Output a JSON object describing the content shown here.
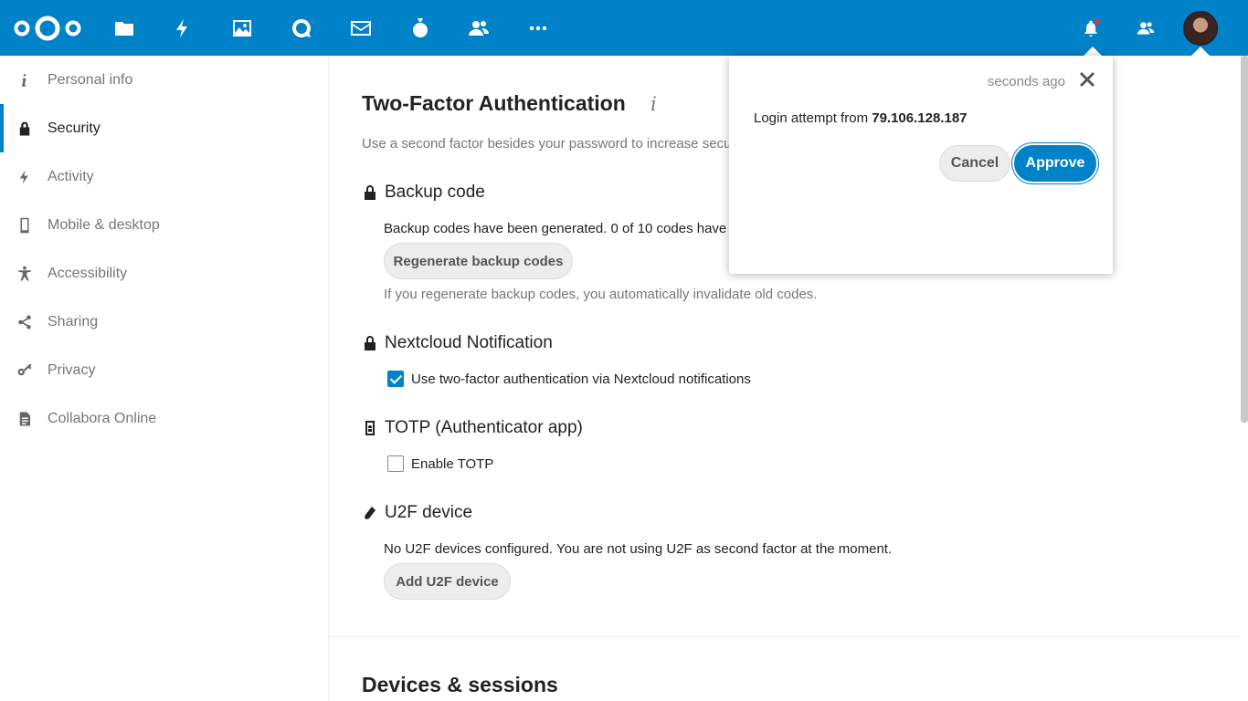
{
  "header": {
    "logo_name": "nextcloud-logo",
    "apps": [
      {
        "name": "files-app-icon"
      },
      {
        "name": "activity-app-icon"
      },
      {
        "name": "photos-app-icon"
      },
      {
        "name": "talk-app-icon"
      },
      {
        "name": "mail-app-icon"
      },
      {
        "name": "deck-app-icon"
      },
      {
        "name": "contacts-app-icon"
      },
      {
        "name": "more-apps-icon"
      }
    ],
    "accent_color": "#0082c9",
    "notification_dot_color": "#e9322d"
  },
  "sidebar": {
    "items": [
      {
        "label": "Personal info",
        "icon": "info-icon"
      },
      {
        "label": "Security",
        "icon": "lock-icon",
        "active": true
      },
      {
        "label": "Activity",
        "icon": "lightning-icon"
      },
      {
        "label": "Mobile & desktop",
        "icon": "phone-icon"
      },
      {
        "label": "Accessibility",
        "icon": "accessibility-icon"
      },
      {
        "label": "Sharing",
        "icon": "share-icon"
      },
      {
        "label": "Privacy",
        "icon": "key-icon"
      },
      {
        "label": "Collabora Online",
        "icon": "document-icon"
      }
    ]
  },
  "main": {
    "title": "Two-Factor Authentication",
    "info_glyph": "i",
    "description": "Use a second factor besides your password to increase secu",
    "backup": {
      "heading": "Backup code",
      "status": "Backup codes have been generated. 0 of 10 codes have b",
      "button": "Regenerate backup codes",
      "hint": "If you regenerate backup codes, you automatically invalidate old codes."
    },
    "nextcloud_notification": {
      "heading": "Nextcloud Notification",
      "checkbox_label": "Use two-factor authentication via Nextcloud notifications",
      "checked": true
    },
    "totp": {
      "heading": "TOTP (Authenticator app)",
      "checkbox_label": "Enable TOTP",
      "checked": false
    },
    "u2f": {
      "heading": "U2F device",
      "status": "No U2F devices configured. You are not using U2F as second factor at the moment.",
      "button": "Add U2F device"
    },
    "devices_title": "Devices & sessions"
  },
  "notification": {
    "time": "seconds ago",
    "message_prefix": "Login attempt from ",
    "ip": "79.106.128.187",
    "cancel": "Cancel",
    "approve": "Approve"
  }
}
